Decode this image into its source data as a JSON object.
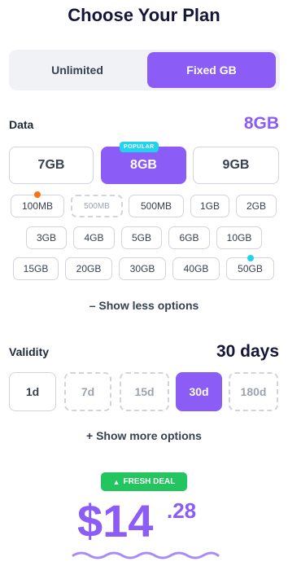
{
  "title": "Choose Your Plan",
  "plan_toggle": {
    "options": [
      "Unlimited",
      "Fixed GB"
    ],
    "selected": "Fixed GB"
  },
  "data": {
    "label": "Data",
    "selected_value": "8GB",
    "main_options": [
      "7GB",
      "8GB",
      "9GB"
    ],
    "popular_badge": "POPULAR",
    "chips_row1": [
      "100MB",
      "500MB",
      "500MB",
      "1GB",
      "2GB"
    ],
    "chips_row2": [
      "3GB",
      "4GB",
      "5GB",
      "6GB",
      "10GB"
    ],
    "chips_row3": [
      "15GB",
      "20GB",
      "30GB",
      "40GB",
      "50GB"
    ],
    "show_less": "– Show less options",
    "colors": {
      "accent": "#8b5cf6",
      "dot_orange": "#f97316",
      "dot_cyan": "#22d3ee"
    }
  },
  "validity": {
    "label": "Validity",
    "selected_value": "30 days",
    "options": [
      "1d",
      "7d",
      "15d",
      "30d",
      "180d"
    ],
    "show_more": "+ Show more options"
  },
  "deal": {
    "icon": "fire-icon",
    "text": "FRESH DEAL",
    "color": "#22c55e"
  },
  "price": {
    "main": "$14",
    "cents": ".28"
  }
}
